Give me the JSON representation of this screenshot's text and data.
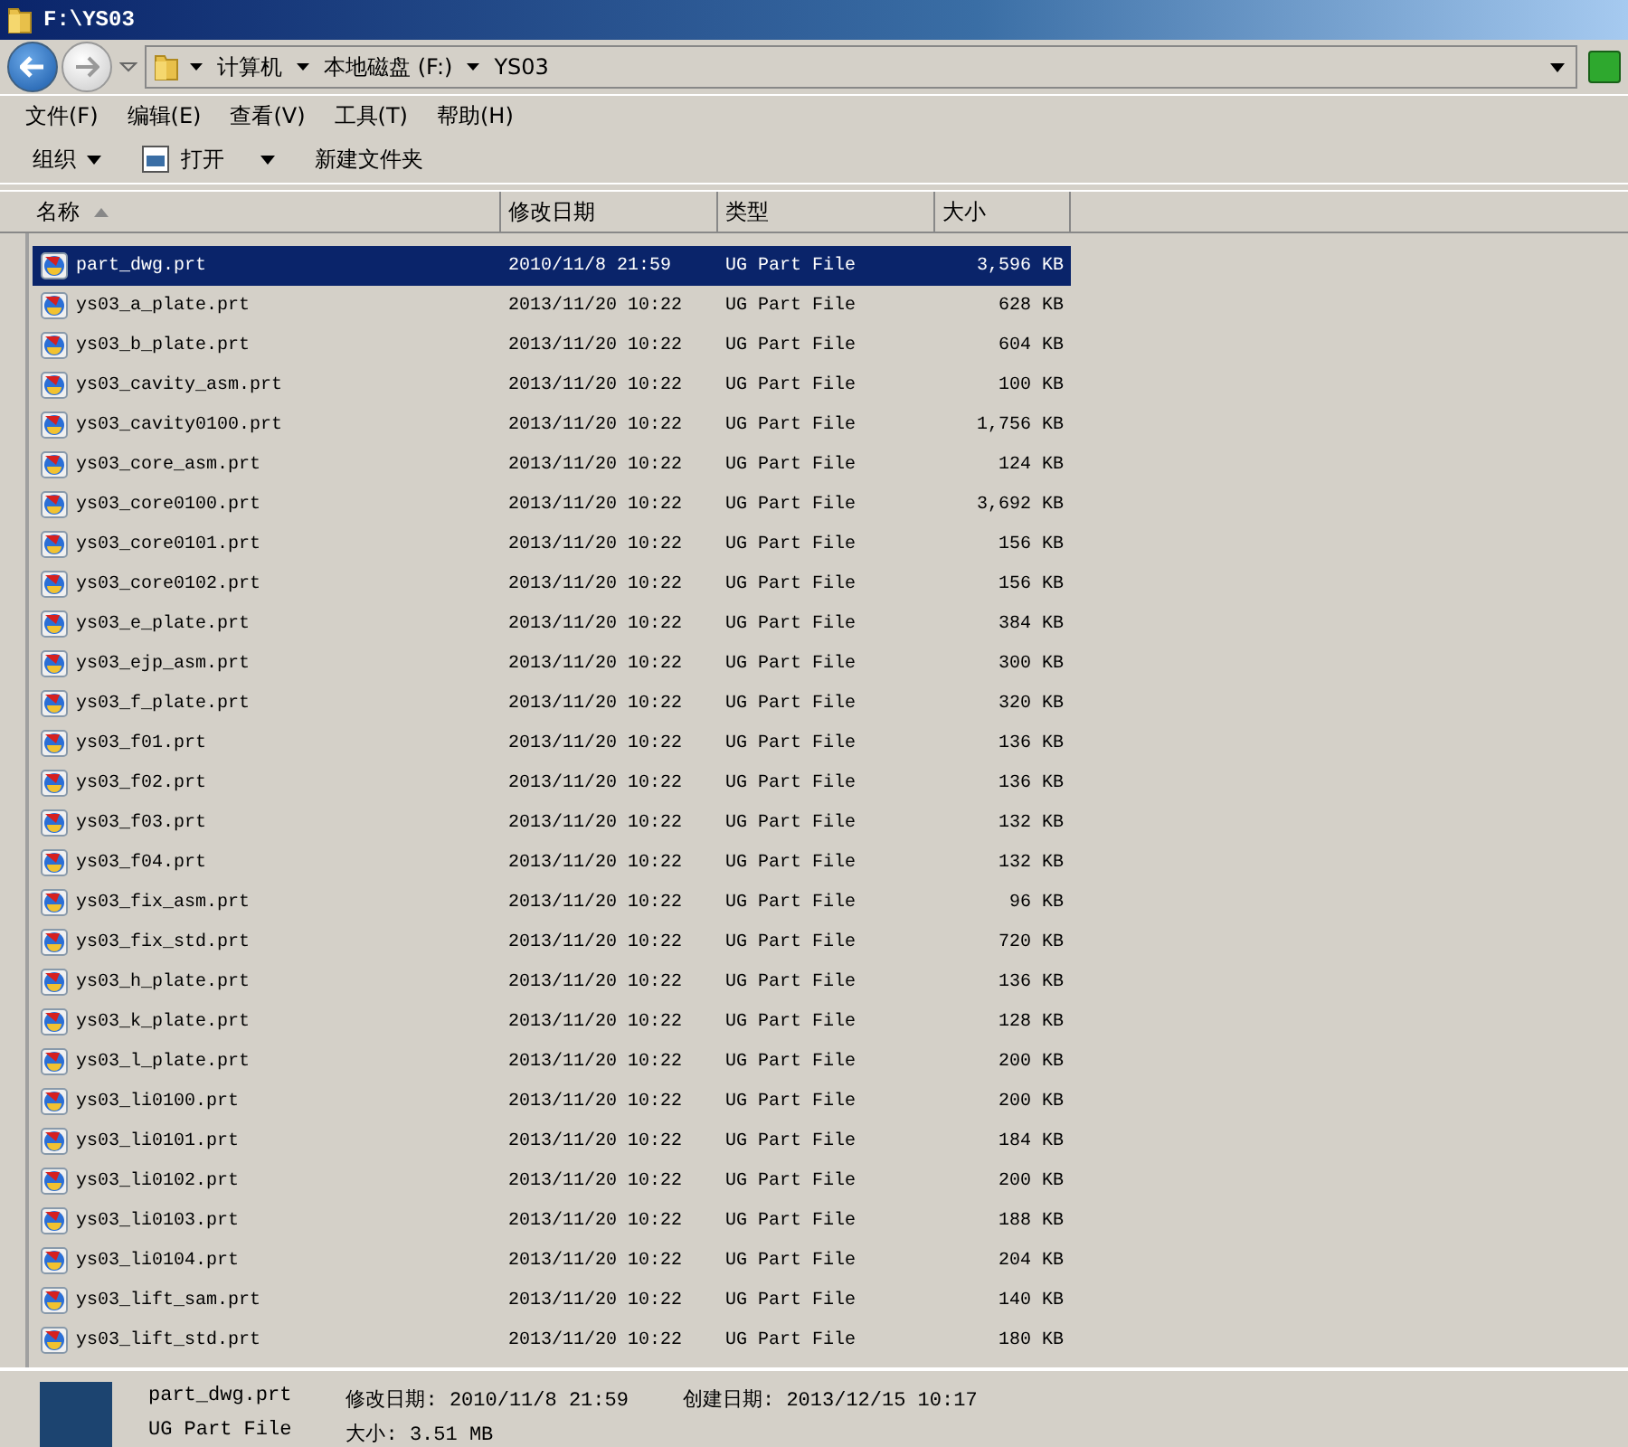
{
  "window": {
    "title": "F:\\YS03"
  },
  "address": {
    "crumbs": [
      "计算机",
      "本地磁盘 (F:)",
      "YS03"
    ]
  },
  "menu": [
    "文件(F)",
    "编辑(E)",
    "查看(V)",
    "工具(T)",
    "帮助(H)"
  ],
  "toolbar": [
    {
      "label": "组织",
      "kind": "dropdown"
    },
    {
      "label": "打开",
      "kind": "open"
    },
    {
      "label": "新建文件夹",
      "kind": "plain"
    }
  ],
  "columns": [
    "名称",
    "修改日期",
    "类型",
    "大小"
  ],
  "rows": [
    {
      "name": "part_dwg.prt",
      "date": "2010/11/8 21:59",
      "type": "UG Part File",
      "size": "3,596 KB",
      "selected": true
    },
    {
      "name": "ys03_a_plate.prt",
      "date": "2013/11/20 10:22",
      "type": "UG Part File",
      "size": "628 KB",
      "selected": false
    },
    {
      "name": "ys03_b_plate.prt",
      "date": "2013/11/20 10:22",
      "type": "UG Part File",
      "size": "604 KB",
      "selected": false
    },
    {
      "name": "ys03_cavity_asm.prt",
      "date": "2013/11/20 10:22",
      "type": "UG Part File",
      "size": "100 KB",
      "selected": false
    },
    {
      "name": "ys03_cavity0100.prt",
      "date": "2013/11/20 10:22",
      "type": "UG Part File",
      "size": "1,756 KB",
      "selected": false
    },
    {
      "name": "ys03_core_asm.prt",
      "date": "2013/11/20 10:22",
      "type": "UG Part File",
      "size": "124 KB",
      "selected": false
    },
    {
      "name": "ys03_core0100.prt",
      "date": "2013/11/20 10:22",
      "type": "UG Part File",
      "size": "3,692 KB",
      "selected": false
    },
    {
      "name": "ys03_core0101.prt",
      "date": "2013/11/20 10:22",
      "type": "UG Part File",
      "size": "156 KB",
      "selected": false
    },
    {
      "name": "ys03_core0102.prt",
      "date": "2013/11/20 10:22",
      "type": "UG Part File",
      "size": "156 KB",
      "selected": false
    },
    {
      "name": "ys03_e_plate.prt",
      "date": "2013/11/20 10:22",
      "type": "UG Part File",
      "size": "384 KB",
      "selected": false
    },
    {
      "name": "ys03_ejp_asm.prt",
      "date": "2013/11/20 10:22",
      "type": "UG Part File",
      "size": "300 KB",
      "selected": false
    },
    {
      "name": "ys03_f_plate.prt",
      "date": "2013/11/20 10:22",
      "type": "UG Part File",
      "size": "320 KB",
      "selected": false
    },
    {
      "name": "ys03_f01.prt",
      "date": "2013/11/20 10:22",
      "type": "UG Part File",
      "size": "136 KB",
      "selected": false
    },
    {
      "name": "ys03_f02.prt",
      "date": "2013/11/20 10:22",
      "type": "UG Part File",
      "size": "136 KB",
      "selected": false
    },
    {
      "name": "ys03_f03.prt",
      "date": "2013/11/20 10:22",
      "type": "UG Part File",
      "size": "132 KB",
      "selected": false
    },
    {
      "name": "ys03_f04.prt",
      "date": "2013/11/20 10:22",
      "type": "UG Part File",
      "size": "132 KB",
      "selected": false
    },
    {
      "name": "ys03_fix_asm.prt",
      "date": "2013/11/20 10:22",
      "type": "UG Part File",
      "size": "96 KB",
      "selected": false
    },
    {
      "name": "ys03_fix_std.prt",
      "date": "2013/11/20 10:22",
      "type": "UG Part File",
      "size": "720 KB",
      "selected": false
    },
    {
      "name": "ys03_h_plate.prt",
      "date": "2013/11/20 10:22",
      "type": "UG Part File",
      "size": "136 KB",
      "selected": false
    },
    {
      "name": "ys03_k_plate.prt",
      "date": "2013/11/20 10:22",
      "type": "UG Part File",
      "size": "128 KB",
      "selected": false
    },
    {
      "name": "ys03_l_plate.prt",
      "date": "2013/11/20 10:22",
      "type": "UG Part File",
      "size": "200 KB",
      "selected": false
    },
    {
      "name": "ys03_li0100.prt",
      "date": "2013/11/20 10:22",
      "type": "UG Part File",
      "size": "200 KB",
      "selected": false
    },
    {
      "name": "ys03_li0101.prt",
      "date": "2013/11/20 10:22",
      "type": "UG Part File",
      "size": "184 KB",
      "selected": false
    },
    {
      "name": "ys03_li0102.prt",
      "date": "2013/11/20 10:22",
      "type": "UG Part File",
      "size": "200 KB",
      "selected": false
    },
    {
      "name": "ys03_li0103.prt",
      "date": "2013/11/20 10:22",
      "type": "UG Part File",
      "size": "188 KB",
      "selected": false
    },
    {
      "name": "ys03_li0104.prt",
      "date": "2013/11/20 10:22",
      "type": "UG Part File",
      "size": "204 KB",
      "selected": false
    },
    {
      "name": "ys03_lift_sam.prt",
      "date": "2013/11/20 10:22",
      "type": "UG Part File",
      "size": "140 KB",
      "selected": false
    },
    {
      "name": "ys03_lift_std.prt",
      "date": "2013/11/20 10:22",
      "type": "UG Part File",
      "size": "180 KB",
      "selected": false
    }
  ],
  "details": {
    "name": "part_dwg.prt",
    "type": "UG Part File",
    "fields": [
      {
        "label": "修改日期:",
        "value": "2010/11/8 21:59"
      },
      {
        "label": "大小:",
        "value": "3.51 MB"
      },
      {
        "label": "创建日期:",
        "value": "2013/12/15 10:17"
      }
    ]
  }
}
